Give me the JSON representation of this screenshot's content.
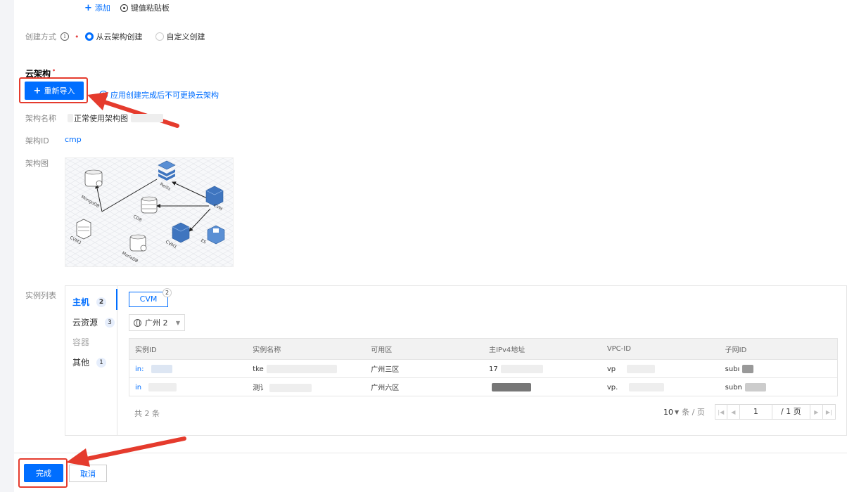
{
  "toolbar": {
    "add_label": "添加",
    "clipboard_label": "键值粘贴板"
  },
  "create_mode": {
    "label": "创建方式",
    "option_from_arch": "从云架构创建",
    "option_custom": "自定义创建",
    "selected": "从云架构创建"
  },
  "cloud_arch": {
    "title": "云架构",
    "reimport_label": "重新导入",
    "notice": "应用创建完成后不可更换云架构",
    "name_label": "架构名称",
    "name_value": "正常使用架构图",
    "id_label": "架构ID",
    "id_value": "cmp",
    "diagram_label": "架构图",
    "diagram_nodes": [
      "MongoDB",
      "Redis",
      "CVM",
      "CDB",
      "CVM3",
      "CVM1",
      "ES",
      "MariaDB"
    ]
  },
  "instances": {
    "section_label": "实例列表",
    "nav": [
      {
        "label": "主机",
        "count": "2",
        "active": true
      },
      {
        "label": "云资源",
        "count": "3",
        "active": false
      },
      {
        "label": "容器",
        "count": "",
        "active": false
      },
      {
        "label": "其他",
        "count": "1",
        "active": false
      }
    ],
    "tab_label": "CVM",
    "tab_count": "2",
    "region": "广州 2",
    "columns": [
      "实例ID",
      "实例名称",
      "可用区",
      "主IPv4地址",
      "VPC-ID",
      "子网ID"
    ],
    "rows": [
      {
        "id": "in:",
        "name": "tke",
        "zone": "广州三区",
        "ip": "17",
        "vpc": "vp",
        "subnet": "subı"
      },
      {
        "id": "in",
        "name": "测讠",
        "zone": "广州六区",
        "ip": "",
        "vpc": "vp.",
        "subnet": "subn"
      }
    ],
    "total": "共 2 条",
    "page_size": "10",
    "page_size_unit": "条 / 页",
    "current_page": "1",
    "page_total": "/ 1 页"
  },
  "footer": {
    "finish_label": "完成",
    "cancel_label": "取消"
  },
  "colors": {
    "accent": "#006eff",
    "highlight": "#e53b2d"
  }
}
